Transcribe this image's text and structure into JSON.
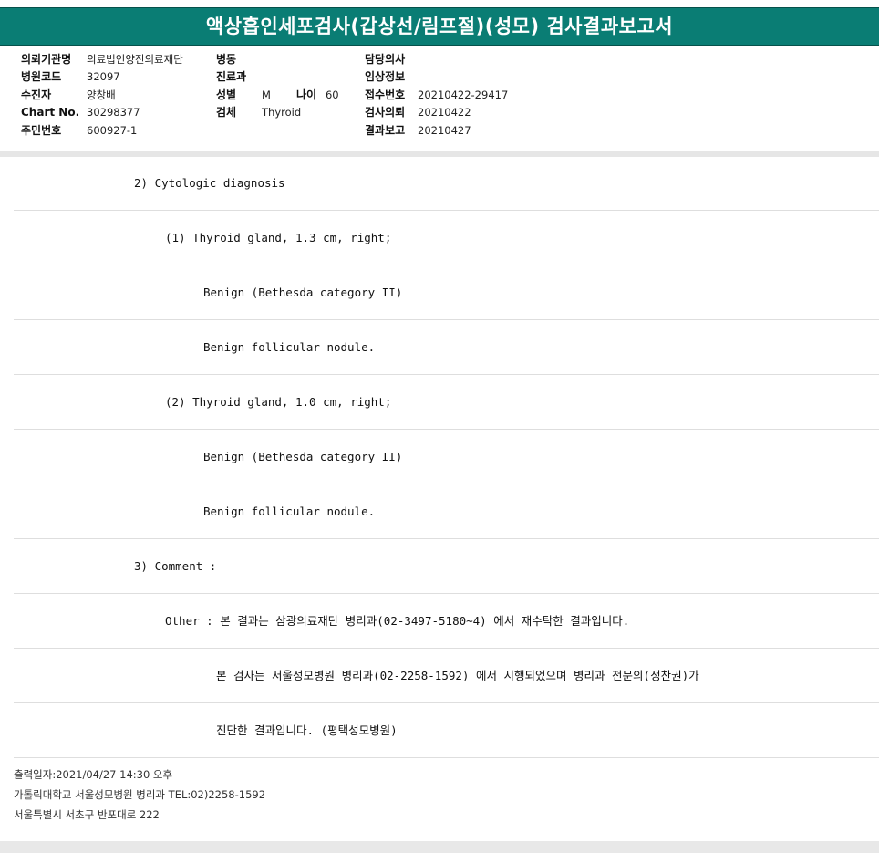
{
  "title": "액상흡인세포검사(갑상선/림프절)(성모) 검사결과보고서",
  "header": {
    "col1": [
      {
        "label": "의뢰기관명",
        "value": "의료법인양진의료재단"
      },
      {
        "label": "병원코드",
        "value": "32097"
      },
      {
        "label": "수진자",
        "value": "양창배"
      },
      {
        "label": "Chart No.",
        "value": "30298377"
      },
      {
        "label": "주민번호",
        "value": "600927-1"
      }
    ],
    "col2": {
      "ward_label": "병동",
      "dept_label": "진료과",
      "sex_label": "성별",
      "sex_value": "M",
      "age_label": "나이",
      "age_value": "60",
      "specimen_label": "검체",
      "specimen_value": "Thyroid"
    },
    "col3": [
      {
        "label": "담당의사",
        "value": ""
      },
      {
        "label": "임상정보",
        "value": ""
      },
      {
        "label": "접수번호",
        "value": "20210422-29417"
      },
      {
        "label": "검사의뢰",
        "value": "20210422"
      },
      {
        "label": "결과보고",
        "value": "20210427"
      }
    ]
  },
  "report_lines": [
    "2) Cytologic diagnosis",
    "(1) Thyroid gland, 1.3 cm, right;",
    "Benign (Bethesda category II)",
    "Benign follicular nodule.",
    "(2) Thyroid gland, 1.0 cm, right;",
    "Benign (Bethesda category II)",
    "Benign follicular nodule.",
    "3) Comment :",
    "Other : 본 결과는 삼광의료재단 병리과(02-3497-5180~4) 에서 재수탁한 결과입니다.",
    "본 검사는 서울성모병원 병리과(02-2258-1592) 에서 시행되었으며 병리과 전문의(정찬권)가",
    "진단한 결과입니다. (평택성모병원)"
  ],
  "footer": {
    "printed": "출력일자:2021/04/27 14:30 오후",
    "hospital": "가톨릭대학교 서울성모병원 병리과 TEL:02)2258-1592",
    "address": "서울특별시 서초구 반포대로 222"
  }
}
